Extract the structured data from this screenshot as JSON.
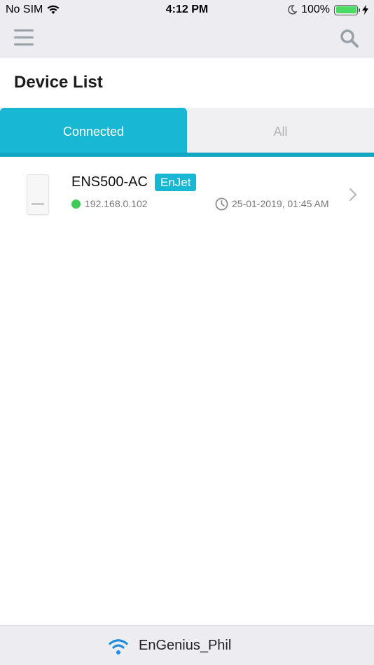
{
  "status_bar": {
    "carrier": "No SIM",
    "time": "4:12 PM",
    "battery_percent": "100%",
    "battery_level": 1.0,
    "battery_color": "#4cd964"
  },
  "nav": {
    "menu_icon": "hamburger-menu-icon",
    "search_icon": "search-icon"
  },
  "page": {
    "title": "Device List"
  },
  "tabs": [
    {
      "label": "Connected",
      "active": true
    },
    {
      "label": "All",
      "active": false
    }
  ],
  "devices": [
    {
      "name": "ENS500-AC",
      "badge": "EnJet",
      "ip": "192.168.0.102",
      "status_color": "#3dcc58",
      "last_seen": "25-01-2019, 01:45 AM"
    }
  ],
  "footer": {
    "network_name": "EnGenius_Phil",
    "accent": "#18b8d4"
  }
}
